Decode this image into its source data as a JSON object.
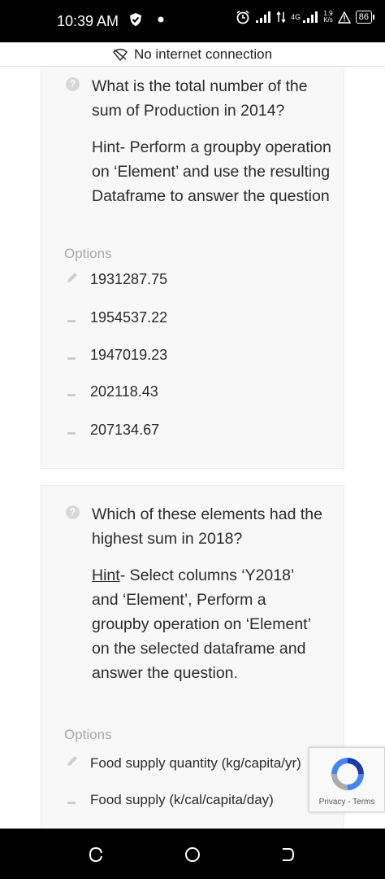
{
  "status_bar": {
    "time": "10:39 AM",
    "network_type": "4G",
    "speed_value": "1.9",
    "speed_unit": "K/s",
    "battery": "86"
  },
  "banner": {
    "text": "No internet connection"
  },
  "cards": [
    {
      "question": "What is the total number of the sum of Production in 2014?",
      "hint": "Hint- Perform a groupby operation on ‘Element’ and use the resulting Dataframe to answer the question",
      "options_label": "Options",
      "options": [
        "1931287.75",
        "1954537.22",
        "1947019.23",
        "202118.43",
        "207134.67"
      ]
    },
    {
      "question": "Which of these elements had the highest sum in 2018?",
      "hint_label": "Hint",
      "hint_rest": "- Select columns ‘Y2018’ and ‘Element’, Perform a groupby operation on ‘Element’ on the selected dataframe and answer the question.",
      "options_label": "Options",
      "options": [
        "Food supply quantity (kg/capita/yr)",
        "Food supply (k/cal/capita/day)"
      ]
    }
  ],
  "recaptcha": {
    "privacy": "Privacy",
    "separator": " - ",
    "terms": "Terms"
  },
  "colors": {
    "status_bar": "#000000",
    "card_bg": "#f8f8f8",
    "options_label": "#a9a9a9",
    "text": "#2b2b2b"
  }
}
